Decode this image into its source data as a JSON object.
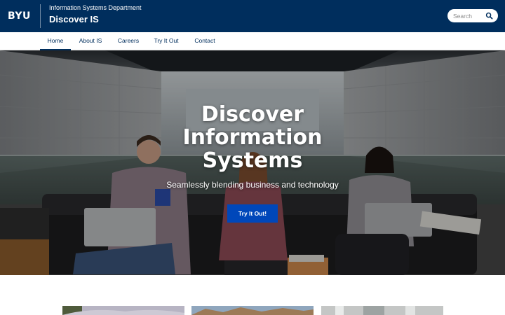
{
  "header": {
    "logo": "BYU",
    "department": "Information Systems Department",
    "site_title": "Discover IS",
    "search_placeholder": "Search"
  },
  "nav": {
    "items": [
      {
        "label": "Home",
        "active": true
      },
      {
        "label": "About IS",
        "active": false
      },
      {
        "label": "Careers",
        "active": false
      },
      {
        "label": "Try It Out",
        "active": false
      },
      {
        "label": "Contact",
        "active": false
      }
    ]
  },
  "hero": {
    "title_lines": [
      "Discover",
      "Information",
      "Systems"
    ],
    "subtitle": "Seamlessly blending business and technology",
    "cta_label": "Try It Out!"
  },
  "colors": {
    "brand_navy": "#002e5d",
    "cta_blue": "#0047ba"
  },
  "cards": [
    {
      "image": "mountain-landscape-photo"
    },
    {
      "image": "canyon-landscape-photo"
    },
    {
      "image": "building-interior-photo"
    }
  ]
}
